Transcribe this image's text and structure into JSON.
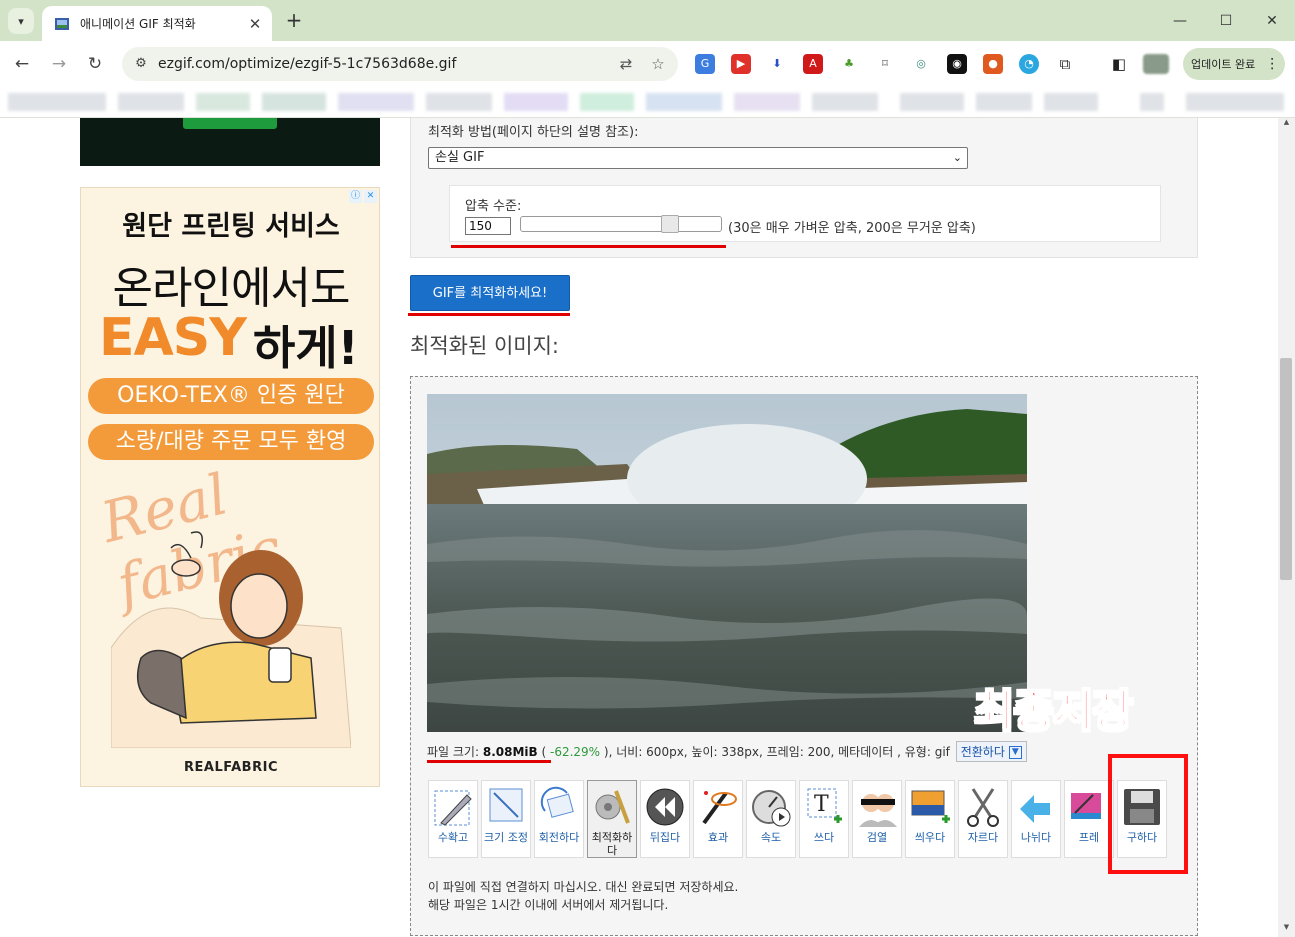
{
  "browser": {
    "tab_title": "애니메이션 GIF 최적화",
    "url": "ezgif.com/optimize/ezgif-5-1c7563d68e.gif",
    "update_label": "업데이트 완료"
  },
  "form": {
    "method_label": "최적화 방법(페이지 하단의 설명 참조):",
    "method_value": "손실 GIF",
    "level_label": "압축 수준:",
    "level_value": "150",
    "level_hint": "(30은 매우 가벼운 압축, 200은 무거운 압축)",
    "optimize_button": "GIF를 최적화하세요!"
  },
  "result": {
    "heading": "최적화된 이미지:",
    "overlay_text": "최종저장",
    "file_size_label": "파일 크기:",
    "file_size": "8.08MiB",
    "size_change": "-62.29%",
    "details": "), 너비: 600px, 높이: 338px, 프레임: 200, 메타데이터 , 유형: gif",
    "convert_label": "전환하다",
    "note1": "이 파일에 직접 연결하지 마십시오. 대신 완료되면 저장하세요.",
    "note2": "해당 파일은 1시간 이내에 서버에서 제거됩니다."
  },
  "tools": [
    {
      "label": "수확고",
      "icon": "crop-icon"
    },
    {
      "label": "크기 조정",
      "icon": "resize-icon"
    },
    {
      "label": "회전하다",
      "icon": "rotate-icon"
    },
    {
      "label": "최적화하다",
      "icon": "optimize-icon"
    },
    {
      "label": "뒤집다",
      "icon": "reverse-icon"
    },
    {
      "label": "효과",
      "icon": "effects-icon"
    },
    {
      "label": "속도",
      "icon": "speed-icon"
    },
    {
      "label": "쓰다",
      "icon": "write-text-icon"
    },
    {
      "label": "검열",
      "icon": "censor-icon"
    },
    {
      "label": "씌우다",
      "icon": "overlay-icon"
    },
    {
      "label": "자르다",
      "icon": "cut-icon"
    },
    {
      "label": "나뉘다",
      "icon": "split-icon"
    },
    {
      "label": "프레",
      "icon": "frames-icon"
    },
    {
      "label": "구하다",
      "icon": "save-icon"
    }
  ],
  "ad": {
    "line1": "원단 프린팅 서비스",
    "line2": "온라인에서도",
    "line3a": "EASY",
    "line3b": "하게!",
    "pill1": "OEKO-TEX® 인증 원단",
    "pill2": "소량/대량 주문 모두 환영",
    "script": "Real fabric",
    "brand": "REALFABRIC"
  },
  "colors": {
    "accent_blue": "#1a6fc9",
    "highlight_red": "#e00000",
    "chrome_green": "#d3e3c8",
    "ad_orange": "#f39a3a"
  }
}
